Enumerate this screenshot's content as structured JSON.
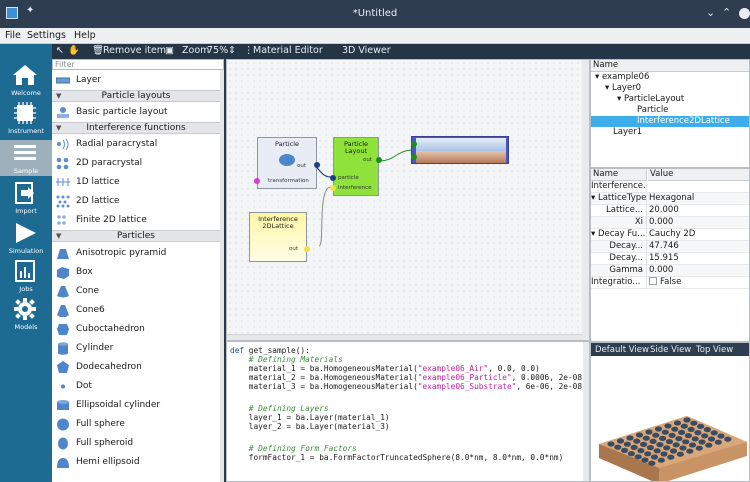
{
  "window": {
    "title": "*Untitled"
  },
  "menu": {
    "file": "File",
    "settings": "Settings",
    "help": "Help"
  },
  "toolbar": {
    "remove_item": "Remove item",
    "zoom_label": "Zoom",
    "zoom_value": "75%",
    "material_editor": "Material Editor",
    "viewer_3d": "3D Viewer"
  },
  "nav": {
    "welcome": "Welcome",
    "instrument": "Instrument",
    "sample": "Sample",
    "import": "Import",
    "simulation": "Simulation",
    "jobs": "Jobs",
    "models": "Models"
  },
  "palette": {
    "filter_placeholder": "Filter",
    "layer": "Layer",
    "cat_particle_layouts": "Particle layouts",
    "basic_particle_layout": "Basic particle layout",
    "cat_interference": "Interference functions",
    "radial_paracrystal": "Radial paracrystal",
    "paracrystal_2d": "2D paracrystal",
    "lattice_1d": "1D lattice",
    "lattice_2d": "2D lattice",
    "finite_lattice_2d": "Finite 2D lattice",
    "cat_particles": "Particles",
    "anisotropic_pyramid": "Anisotropic pyramid",
    "box": "Box",
    "cone": "Cone",
    "cone6": "Cone6",
    "cuboctahedron": "Cuboctahedron",
    "cylinder": "Cylinder",
    "dodecahedron": "Dodecahedron",
    "dot": "Dot",
    "ellipsoidal_cylinder": "Ellipsoidal cylinder",
    "full_sphere": "Full sphere",
    "full_spheroid": "Full spheroid",
    "hemi_ellipsoid": "Hemi ellipsoid"
  },
  "canvas": {
    "particle_node": {
      "title": "Particle",
      "out": "out",
      "transformation": "transformation"
    },
    "layout_node": {
      "title_1": "Particle",
      "title_2": "Layout",
      "out": "out",
      "particle": "particle",
      "interference": "interference"
    },
    "interference_node": {
      "title_1": "Interference",
      "title_2": "2DLattice",
      "out": "out"
    }
  },
  "code": {
    "l1a": "def",
    "l1b": " get_sample():",
    "l2": "    # Defining Materials",
    "l3a": "    material_1 = ba.HomogeneousMaterial(",
    "l3b": "\"example06_Air\"",
    "l3c": ", 0.0, 0.0)",
    "l4a": "    material_2 = ba.HomogeneousMaterial(",
    "l4b": "\"example06_Particle\"",
    "l4c": ", 0.0006, 2e-08)",
    "l5a": "    material_3 = ba.HomogeneousMaterial(",
    "l5b": "\"example06_Substrate\"",
    "l5c": ", 6e-06, 2e-08)",
    "l6": "    # Defining Layers",
    "l7": "    layer_1 = ba.Layer(material_1)",
    "l8": "    layer_2 = ba.Layer(material_3)",
    "l9": "    # Defining Form Factors",
    "l10": "    formFactor_1 = ba.FormFactorTruncatedSphere(8.0*nm, 8.0*nm, 0.0*nm)"
  },
  "tree": {
    "header": "Name",
    "items": [
      "example06",
      "Layer0",
      "ParticleLayout",
      "Particle",
      "Interference2DLattice",
      "Layer1"
    ]
  },
  "props": {
    "name_header": "Name",
    "value_header": "Value",
    "title_row": "Interference...",
    "rows": [
      {
        "name": "LatticeType",
        "value": "Hexagonal"
      },
      {
        "name": "Lattice...",
        "value": "20.000"
      },
      {
        "name": "Xi",
        "value": "0.000"
      },
      {
        "name": "Decay Fu...",
        "value": "Cauchy 2D"
      },
      {
        "name": "Decay...",
        "value": "47.746"
      },
      {
        "name": "Decay...",
        "value": "15.915"
      },
      {
        "name": "Gamma",
        "value": "0.000"
      },
      {
        "name": "Integratio...",
        "value": "False"
      }
    ]
  },
  "view3d": {
    "default_view": "Default View",
    "side_view": "Side View",
    "top_view": "Top View"
  },
  "colors": {
    "accent": "#3daee9",
    "nav_bg": "#1d6a92",
    "layout_node": "#8ee23a",
    "interference_node": "#fff7b0"
  }
}
